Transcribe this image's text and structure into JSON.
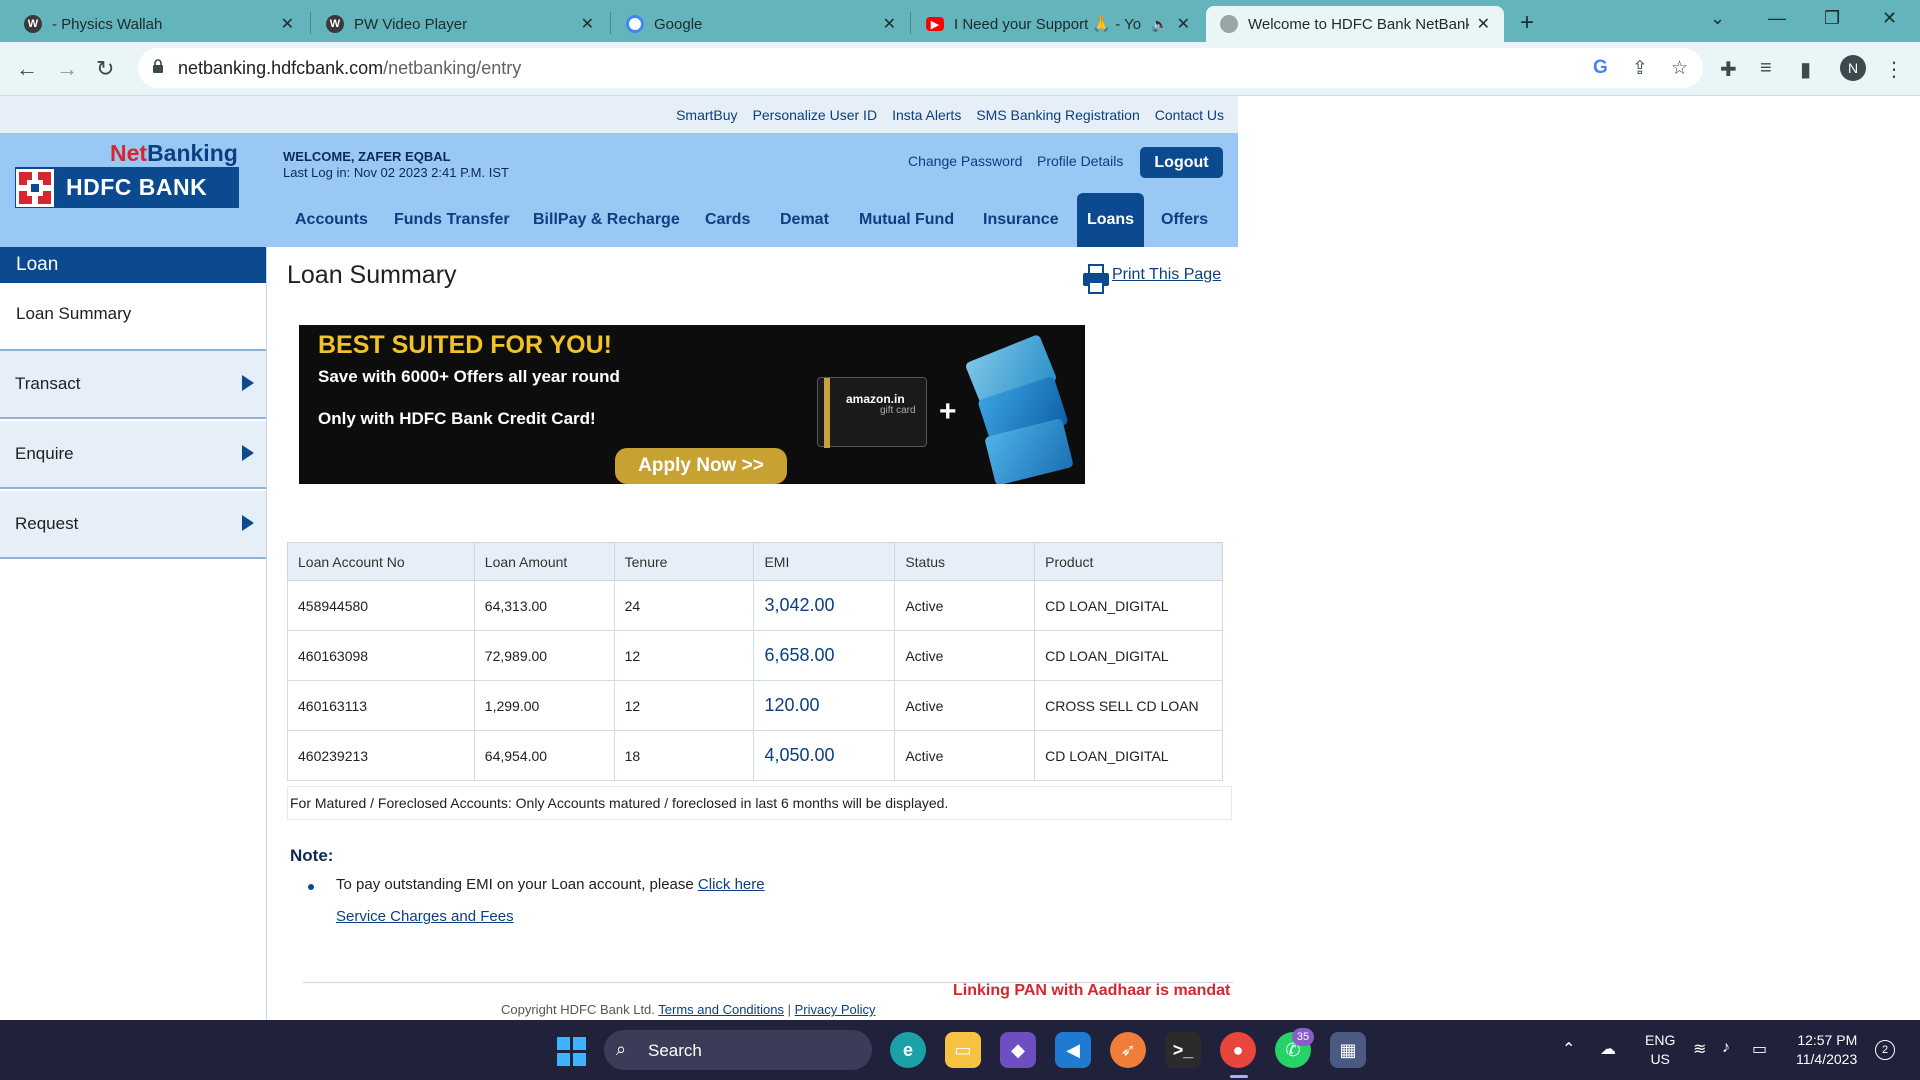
{
  "browser": {
    "tabs": [
      {
        "title": "- Physics Wallah",
        "icon": "wordpress-icon"
      },
      {
        "title": "PW Video Player",
        "icon": "wordpress-icon"
      },
      {
        "title": "Google",
        "icon": "google-icon"
      },
      {
        "title": "I Need your Support 🙏 - Yo",
        "icon": "youtube-icon"
      },
      {
        "title": "Welcome to HDFC Bank NetBanki",
        "icon": "globe-icon"
      }
    ],
    "url_host": "netbanking.hdfcbank.com",
    "url_path": "/netbanking/entry",
    "profile_initial": "N"
  },
  "toplinks": [
    "SmartBuy",
    "Personalize User ID",
    "Insta Alerts",
    "SMS Banking Registration",
    "Contact Us"
  ],
  "header": {
    "logo_net": "Net",
    "logo_banking": "Banking",
    "logo_bank": "HDFC BANK",
    "welcome": "WELCOME, ZAFER EQBAL",
    "last_login": "Last Log in: Nov 02 2023 2:41 P.M. IST",
    "change_password": "Change Password",
    "profile_details": "Profile Details",
    "logout": "Logout"
  },
  "nav": [
    "Accounts",
    "Funds Transfer",
    "BillPay & Recharge",
    "Cards",
    "Demat",
    "Mutual Fund",
    "Insurance",
    "Loans",
    "Offers"
  ],
  "nav_active": "Loans",
  "sidebar": {
    "heading": "Loan",
    "sub": "Loan Summary",
    "items": [
      "Transact",
      "Enquire",
      "Request"
    ]
  },
  "main": {
    "title": "Loan Summary",
    "print": "Print This Page"
  },
  "banner": {
    "title": "BEST SUITED FOR YOU!",
    "line1": "Save with 6000+ Offers all year round",
    "line2": "Only with HDFC Bank Credit Card!",
    "cta": "Apply Now >>",
    "gift_brand": "amazon.in",
    "gift_sub": "gift card",
    "plus": "+"
  },
  "loans": {
    "columns": [
      "Loan Account No",
      "Loan Amount",
      "Tenure",
      "EMI",
      "Status",
      "Product"
    ],
    "rows": [
      [
        "458944580",
        "64,313.00",
        "24",
        "3,042.00",
        "Active",
        "CD LOAN_DIGITAL"
      ],
      [
        "460163098",
        "72,989.00",
        "12",
        "6,658.00",
        "Active",
        "CD LOAN_DIGITAL"
      ],
      [
        "460163113",
        "1,299.00",
        "12",
        "120.00",
        "Active",
        "CROSS SELL CD LOAN"
      ],
      [
        "460239213",
        "64,954.00",
        "18",
        "4,050.00",
        "Active",
        "CD LOAN_DIGITAL"
      ]
    ]
  },
  "footnote": "For Matured / Foreclosed Accounts: Only Accounts matured / foreclosed in last 6 months will be displayed.",
  "note": {
    "title": "Note:",
    "text": "To pay outstanding EMI on your Loan account, please ",
    "click_here": "Click here",
    "fees_link": "Service Charges and Fees"
  },
  "footer": {
    "alert": "Linking PAN with Aadhaar is mandat",
    "copyright": "Copyright HDFC Bank Ltd. ",
    "terms": "Terms and Conditions",
    "sep": " | ",
    "privacy": "Privacy Policy"
  },
  "taskbar": {
    "search": "Search",
    "whatsapp_badge": "35",
    "lang1": "ENG",
    "lang2": "US",
    "time": "12:57 PM",
    "date": "11/4/2023",
    "notifications": "2"
  },
  "colors": {
    "brand_blue": "#0b4a8f",
    "brand_red": "#d6262f",
    "header_bg": "#99c8f4",
    "tabbar_bg": "#63b5bb"
  }
}
